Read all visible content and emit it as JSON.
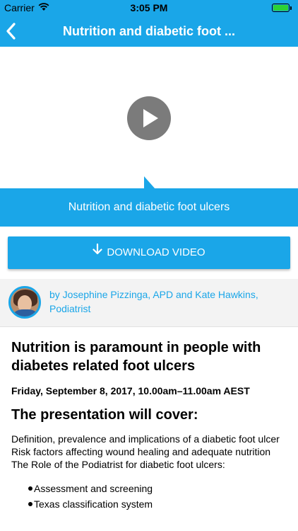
{
  "status_bar": {
    "carrier": "Carrier",
    "time": "3:05 PM",
    "battery_level": 1.0
  },
  "nav": {
    "title": "Nutrition and diabetic foot ...",
    "back_icon": "chevron-left-icon"
  },
  "video": {
    "play_icon": "play-icon",
    "caption": "Nutrition and diabetic foot ulcers"
  },
  "download": {
    "label": "DOWNLOAD VIDEO",
    "icon": "download-arrow-icon"
  },
  "author": {
    "byline": "by Josephine Pizzinga, APD and Kate Hawkins, Podiatrist"
  },
  "article": {
    "heading": "Nutrition is paramount in people with diabetes related foot ulcers",
    "date": "Friday, September 8, 2017, 10.00am–11.00am AEST",
    "subheading": "The presentation will cover:",
    "lines": [
      "Definition, prevalence and implications of a diabetic foot ulcer",
      "Risk factors affecting wound healing and adequate nutrition",
      "The Role of the Podiatrist for diabetic foot ulcers:"
    ],
    "bullets": [
      "Assessment and screening",
      "Texas classification system"
    ]
  },
  "colors": {
    "accent": "#1aa6e8",
    "play_button": "#7b7b7b"
  }
}
